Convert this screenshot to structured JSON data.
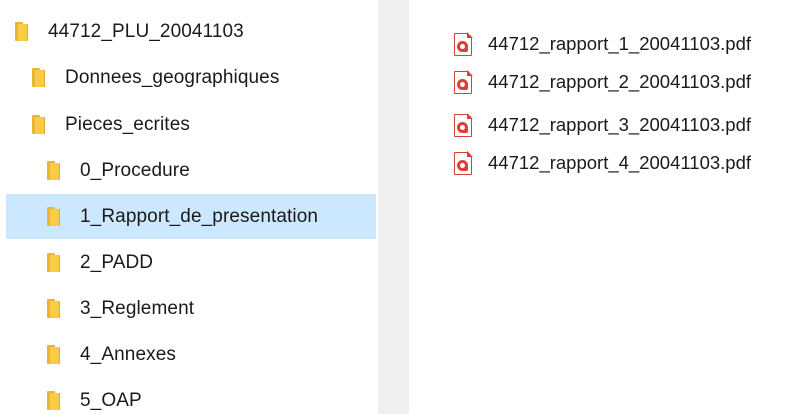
{
  "tree": {
    "items": [
      {
        "label": "44712_PLU_20041103",
        "icon": "folder-icon",
        "level": 0,
        "selected": false
      },
      {
        "label": "Donnees_geographiques",
        "icon": "folder-icon",
        "level": 1,
        "selected": false
      },
      {
        "label": "Pieces_ecrites",
        "icon": "folder-icon",
        "level": 1,
        "selected": false
      },
      {
        "label": "0_Procedure",
        "icon": "folder-icon",
        "level": 2,
        "selected": false
      },
      {
        "label": "1_Rapport_de_presentation",
        "icon": "folder-icon",
        "level": 2,
        "selected": true
      },
      {
        "label": "2_PADD",
        "icon": "folder-icon",
        "level": 2,
        "selected": false
      },
      {
        "label": "3_Reglement",
        "icon": "folder-icon",
        "level": 2,
        "selected": false
      },
      {
        "label": "4_Annexes",
        "icon": "folder-icon",
        "level": 2,
        "selected": false
      },
      {
        "label": "5_OAP",
        "icon": "folder-icon",
        "level": 2,
        "selected": false
      }
    ]
  },
  "files": {
    "items": [
      {
        "name": "44712_rapport_1_20041103.pdf",
        "icon": "pdf-file-icon"
      },
      {
        "name": "44712_rapport_2_20041103.pdf",
        "icon": "pdf-file-icon"
      },
      {
        "name": "44712_rapport_3_20041103.pdf",
        "icon": "pdf-file-icon"
      },
      {
        "name": "44712_rapport_4_20041103.pdf",
        "icon": "pdf-file-icon"
      }
    ]
  },
  "colors": {
    "selection": "#cce8ff",
    "folder": "#f8cd45",
    "pdf_accent": "#d9403a",
    "splitter": "#f0f0f0"
  }
}
